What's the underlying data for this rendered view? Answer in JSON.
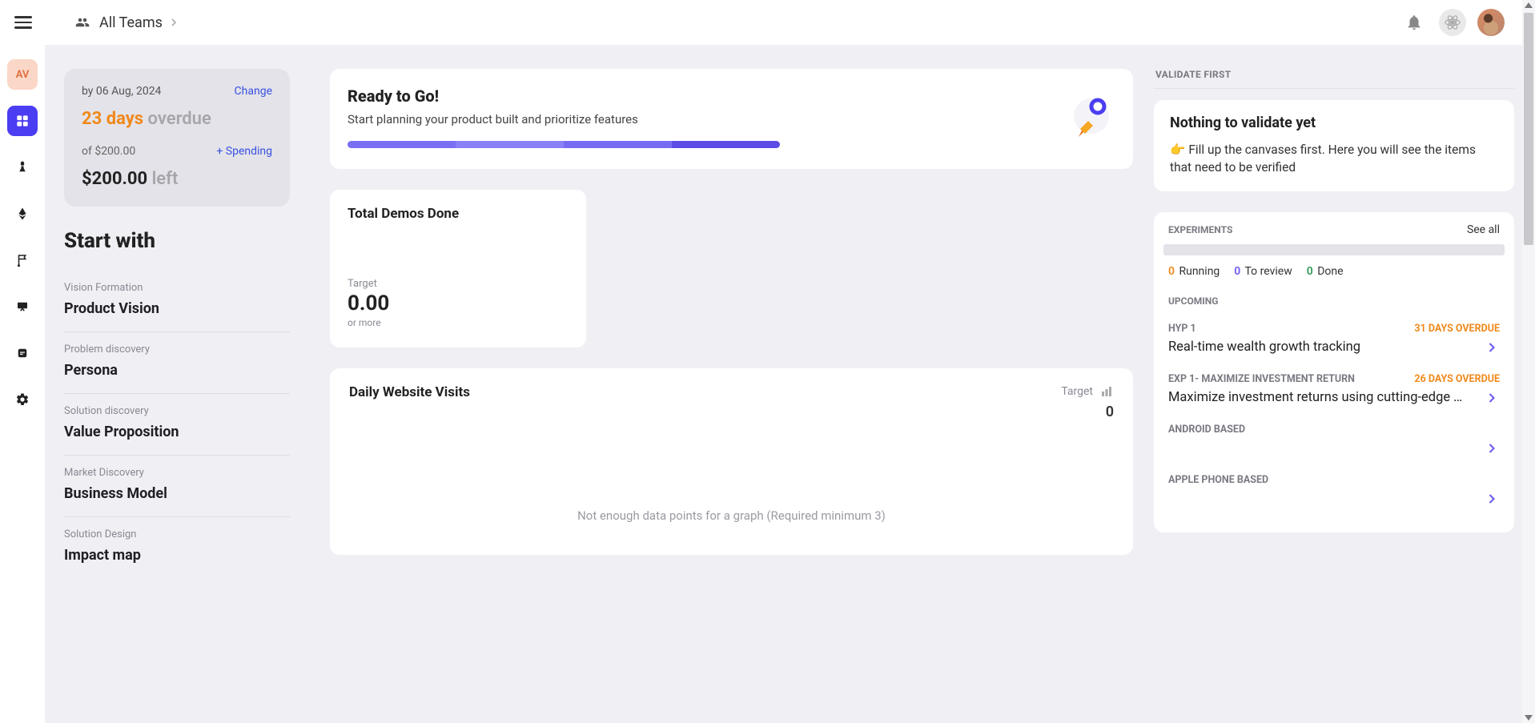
{
  "header": {
    "team_label": "All Teams"
  },
  "rail": {
    "avatar_initials": "AV"
  },
  "summary": {
    "date_prefix": "by 06 Aug, 2024",
    "change_link": "Change",
    "overdue_value": "23 days",
    "overdue_label": " overdue",
    "of_budget": "of $200.00",
    "spending_link": "+ Spending",
    "left_value": "$200.00",
    "left_label": " left"
  },
  "start": {
    "heading": "Start with",
    "steps": [
      {
        "category": "Vision Formation",
        "title": "Product Vision"
      },
      {
        "category": "Problem discovery",
        "title": "Persona"
      },
      {
        "category": "Solution discovery",
        "title": "Value Proposition"
      },
      {
        "category": "Market Discovery",
        "title": "Business Model"
      },
      {
        "category": "Solution Design",
        "title": "Impact map"
      }
    ]
  },
  "ready": {
    "title": "Ready to Go!",
    "subtitle": "Start planning your product built and prioritize features"
  },
  "demos": {
    "title": "Total Demos Done",
    "target_label": "Target",
    "target_value": "0.00",
    "target_more": "or more"
  },
  "visits": {
    "title": "Daily Website Visits",
    "target_label": "Target",
    "target_value": "0",
    "no_data": "Not enough data points for a graph (Required minimum 3)"
  },
  "validate": {
    "section_label": "VALIDATE FIRST",
    "title": "Nothing to validate yet",
    "emoji": "👉",
    "body": "Fill up the canvases first. Here you will see the items that need to be verified"
  },
  "experiments": {
    "label": "EXPERIMENTS",
    "see_all": "See all",
    "counts": {
      "running_n": "0",
      "running_l": "Running",
      "review_n": "0",
      "review_l": "To review",
      "done_n": "0",
      "done_l": "Done"
    },
    "upcoming_label": "UPCOMING",
    "items": [
      {
        "code": "HYP 1",
        "due": "31 DAYS OVERDUE",
        "desc": "Real-time wealth growth tracking"
      },
      {
        "code": "EXP 1- MAXIMIZE INVESTMENT RETURN",
        "due": "26 DAYS OVERDUE",
        "desc": "Maximize investment returns using cutting-edge …"
      },
      {
        "code": "ANDROID BASED",
        "due": "",
        "desc": ""
      },
      {
        "code": "APPLE PHONE BASED",
        "due": "",
        "desc": ""
      }
    ]
  }
}
